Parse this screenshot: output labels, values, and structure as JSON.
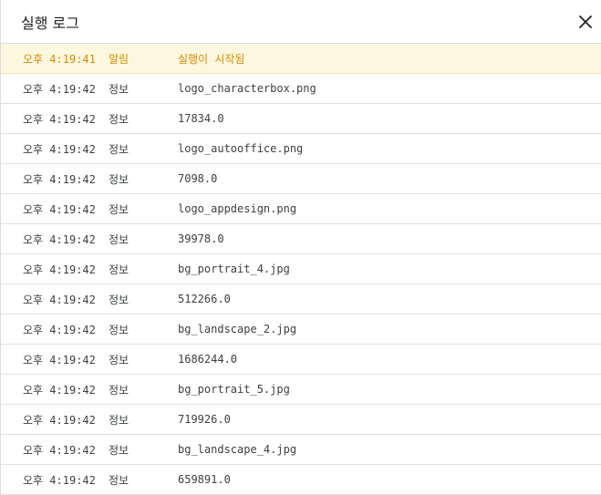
{
  "dialog": {
    "title": "실행 로그",
    "close_icon": "close-icon"
  },
  "colors": {
    "warn_background": "#fef7e0",
    "warn_text": "#d48c00",
    "info_text": "#3c4043"
  },
  "log": {
    "entries": [
      {
        "time": "오후 4:19:41",
        "level": "알림",
        "message": "실행이 시작됨",
        "type": "warn"
      },
      {
        "time": "오후 4:19:42",
        "level": "정보",
        "message": "logo_characterbox.png",
        "type": "info"
      },
      {
        "time": "오후 4:19:42",
        "level": "정보",
        "message": "17834.0",
        "type": "info"
      },
      {
        "time": "오후 4:19:42",
        "level": "정보",
        "message": "logo_autooffice.png",
        "type": "info"
      },
      {
        "time": "오후 4:19:42",
        "level": "정보",
        "message": "7098.0",
        "type": "info"
      },
      {
        "time": "오후 4:19:42",
        "level": "정보",
        "message": "logo_appdesign.png",
        "type": "info"
      },
      {
        "time": "오후 4:19:42",
        "level": "정보",
        "message": "39978.0",
        "type": "info"
      },
      {
        "time": "오후 4:19:42",
        "level": "정보",
        "message": "bg_portrait_4.jpg",
        "type": "info"
      },
      {
        "time": "오후 4:19:42",
        "level": "정보",
        "message": "512266.0",
        "type": "info"
      },
      {
        "time": "오후 4:19:42",
        "level": "정보",
        "message": "bg_landscape_2.jpg",
        "type": "info"
      },
      {
        "time": "오후 4:19:42",
        "level": "정보",
        "message": "1686244.0",
        "type": "info"
      },
      {
        "time": "오후 4:19:42",
        "level": "정보",
        "message": "bg_portrait_5.jpg",
        "type": "info"
      },
      {
        "time": "오후 4:19:42",
        "level": "정보",
        "message": "719926.0",
        "type": "info"
      },
      {
        "time": "오후 4:19:42",
        "level": "정보",
        "message": "bg_landscape_4.jpg",
        "type": "info"
      },
      {
        "time": "오후 4:19:42",
        "level": "정보",
        "message": "659891.0",
        "type": "info"
      }
    ]
  }
}
